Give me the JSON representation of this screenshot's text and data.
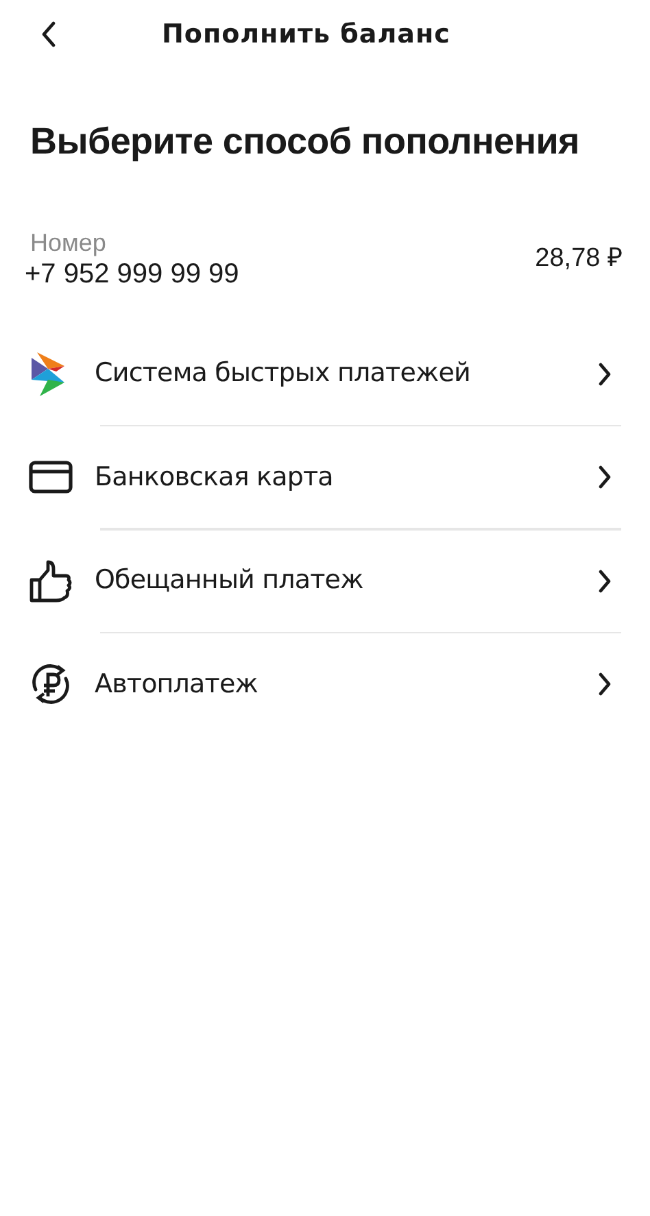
{
  "header": {
    "title": "Пополнить баланс"
  },
  "heading": "Выберите способ пополнения",
  "account": {
    "label": "Номер",
    "number": "+7 952 999 99 99",
    "balance": "28,78 ₽"
  },
  "methods": [
    {
      "kind": "sbp",
      "label": "Система быстрых платежей"
    },
    {
      "kind": "card",
      "label": "Банковская карта"
    },
    {
      "kind": "thumb",
      "label": "Обещанный платеж"
    },
    {
      "kind": "autopay",
      "label": "Автоплатеж"
    }
  ]
}
